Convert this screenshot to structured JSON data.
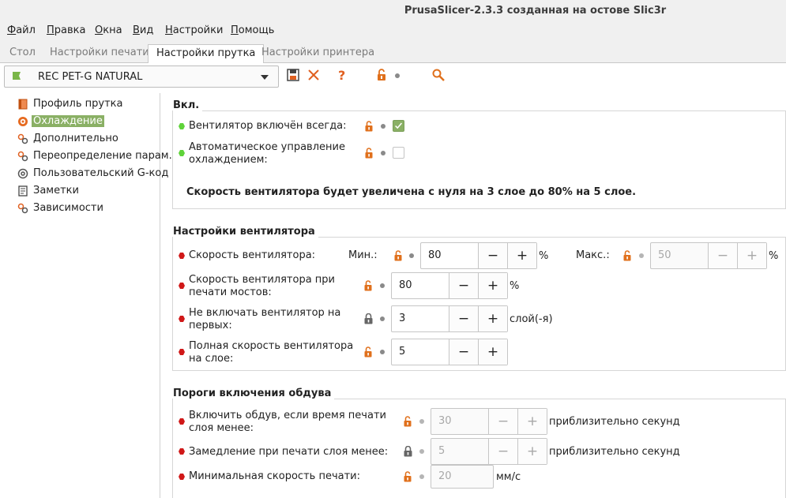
{
  "window": {
    "title": "PrusaSlicer-2.3.3 созданная на остове Slic3r"
  },
  "menu": {
    "items": [
      "Файл",
      "Правка",
      "Окна",
      "Вид",
      "Настройки",
      "Помощь"
    ]
  },
  "tabs": {
    "items": [
      "Стол",
      "Настройки печати",
      "Настройки прутка",
      "Настройки принтера"
    ],
    "active_index": 2
  },
  "preset": {
    "name": "REC PET-G NATURAL",
    "flag_color": "#7ab648"
  },
  "toolbar": {
    "icons": [
      "save-icon",
      "delete-icon",
      "question-icon",
      "unlock-icon",
      "search-icon"
    ]
  },
  "sidebar": {
    "items": [
      {
        "label": "Профиль прутка",
        "icon": "filament-icon"
      },
      {
        "label": "Охлаждение",
        "icon": "cooling-icon",
        "selected": true
      },
      {
        "label": "Дополнительно",
        "icon": "advanced-icon"
      },
      {
        "label": "Переопределение парам.",
        "icon": "override-icon"
      },
      {
        "label": "Пользовательский G-код",
        "icon": "gcode-icon"
      },
      {
        "label": "Заметки",
        "icon": "notes-icon"
      },
      {
        "label": "Зависимости",
        "icon": "dependencies-icon"
      }
    ]
  },
  "enable": {
    "title": "Вкл.",
    "fan_always_on": {
      "label": "Вентилятор включён всегда:",
      "checked": true
    },
    "auto_cooling": {
      "label": "Автоматическое управление охлаждением:",
      "line1": "Автоматическое управление",
      "line2": "охлаждением:",
      "checked": false
    },
    "note": "Скорость вентилятора будет увеличена с нуля на 3 слое до 80% на 5 слое."
  },
  "fan": {
    "title": "Настройки вентилятора",
    "speed": {
      "label": "Скорость вентилятора:",
      "min_label": "Мин.:",
      "min_value": "80",
      "max_label": "Макс.:",
      "max_value": "50",
      "unit": "%"
    },
    "bridges": {
      "line1": "Скорость вентилятора при",
      "line2": "печати мостов:",
      "value": "80",
      "unit": "%"
    },
    "disable_first": {
      "line1": "Не включать вентилятор на",
      "line2": "первых:",
      "value": "3",
      "unit": "слой(-я)"
    },
    "full_at": {
      "line1": "Полная скорость вентилятора",
      "line2": "на слое:",
      "value": "5"
    }
  },
  "thresholds": {
    "title": "Пороги включения обдува",
    "enable_below": {
      "line1": "Включить обдув, если время печати",
      "line2": "слоя менее:",
      "value": "30",
      "unit": "приблизительно секунд"
    },
    "slowdown_below": {
      "label": "Замедление при печати слоя менее:",
      "value": "5",
      "unit": "приблизительно секунд"
    },
    "min_speed": {
      "label": "Минимальная скорость печати:",
      "value": "20",
      "unit": "мм/с"
    }
  },
  "colors": {
    "accent": "#8ab065",
    "lock_orange": "#e0701c",
    "bullet_green": "#5fd33a",
    "bullet_red": "#d01818"
  },
  "symbols": {
    "minus": "−",
    "plus": "+"
  }
}
